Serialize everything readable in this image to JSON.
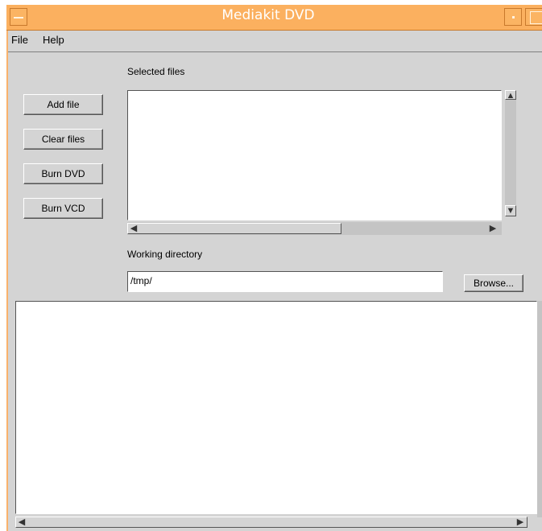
{
  "window": {
    "title": "Mediakit DVD"
  },
  "menu": {
    "file": "File",
    "help": "Help"
  },
  "buttons": {
    "add_file": "Add file",
    "clear_files": "Clear files",
    "burn_dvd": "Burn DVD",
    "burn_vcd": "Burn VCD",
    "browse": "Browse..."
  },
  "labels": {
    "selected_files": "Selected files",
    "working_directory": "Working directory"
  },
  "working_directory": {
    "value": "/tmp/"
  },
  "selected_files": [],
  "icons": {
    "window_menu": "window-menu-icon",
    "minimize": "minimize-icon",
    "maximize": "maximize-icon",
    "arrow_up": "arrow-up-icon",
    "arrow_down": "arrow-down-icon",
    "arrow_left": "arrow-left-icon",
    "arrow_right": "arrow-right-icon"
  },
  "colors": {
    "titlebar": "#fbb05f",
    "panel": "#d4d4d4"
  }
}
